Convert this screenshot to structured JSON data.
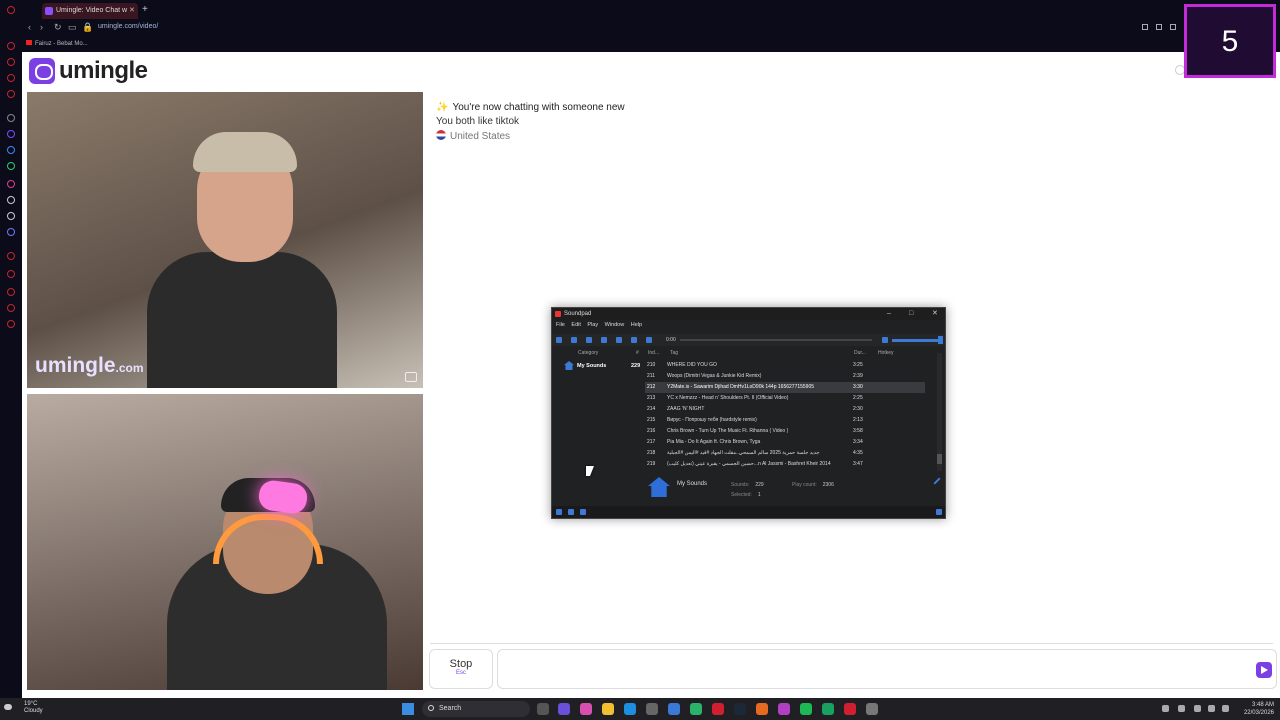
{
  "browser": {
    "tab_title": "Umingle: Video Chat w",
    "url": "umingle.com/video/",
    "bookmark": "Fairuz - Bebat Mo..."
  },
  "site": {
    "logo_text": "umingle",
    "watermark_main": "umingle",
    "watermark_suffix": ".com"
  },
  "chat": {
    "line1": "You're now chatting with someone new",
    "line2": "You both like tiktok",
    "line3": "United States"
  },
  "controls": {
    "stop_label": "Stop",
    "stop_hint": "Esc",
    "message_placeholder": ""
  },
  "soundpad": {
    "title": "Soundpad",
    "menu": [
      "File",
      "Edit",
      "Play",
      "Window",
      "Help"
    ],
    "time": "0:00",
    "columns": {
      "category": "Category",
      "count": "#",
      "index": "Ind...",
      "tag": "Tag",
      "duration": "Dur...",
      "hotkey": "Hotkey"
    },
    "category": {
      "name": "My Sounds",
      "count": "229"
    },
    "rows": [
      {
        "idx": "210",
        "tag": "WHERE DID YOU GO",
        "dur": "3:25"
      },
      {
        "idx": "211",
        "tag": "Woops (Dimitri Vegas & Junkie Kid Remix)",
        "dur": "2:39"
      },
      {
        "idx": "212",
        "tag": "Y2Mate.is - Sawarim Djihad DmHv1LoD90k 144p 1656277155905",
        "dur": "3:30"
      },
      {
        "idx": "213",
        "tag": "YC x Nemzzz - Head n' Shoulders Pt. II (Official Video)",
        "dur": "2:25"
      },
      {
        "idx": "214",
        "tag": "ZAAG 'N' NIGHT",
        "dur": "2:30"
      },
      {
        "idx": "215",
        "tag": "Вирус - Попрошу тебя (hardstyle remix)",
        "dur": "2:13"
      },
      {
        "idx": "216",
        "tag": "Chris Brown - Turn Up The Music Ft. Rihanna ( Video )",
        "dur": "3:58"
      },
      {
        "idx": "217",
        "tag": "Pia Mia - Do It Again ft. Chris Brown, Tyga",
        "dur": "3:34"
      },
      {
        "idx": "218",
        "tag": "جديد جلسة حمرية 2025 سالم السمحي..مقلت الجهاد #قيد #اليمن #الجبلية",
        "dur": "4:35"
      },
      {
        "idx": "219",
        "tag": "حسين الجسمي - يقبرة عيني (تعديل كليب)...n Al Jassmi - Bashret Kheir 2014",
        "dur": "3:47"
      }
    ],
    "footer": {
      "title": "My Sounds",
      "sounds_label": "Sounds:",
      "sounds_value": "229",
      "play_label": "Play count:",
      "play_value": "2306",
      "selected_label": "Selected:",
      "selected_value": "1"
    }
  },
  "counter": "5",
  "taskbar": {
    "temp": "19°C",
    "weather": "Cloudy",
    "search": "Search",
    "time": "3:48 AM",
    "date": "22/03/2026"
  },
  "colors": {
    "brand": "#7b3fe4",
    "counter_border": "#c32bd9",
    "soundpad_accent": "#3d7ad6"
  }
}
